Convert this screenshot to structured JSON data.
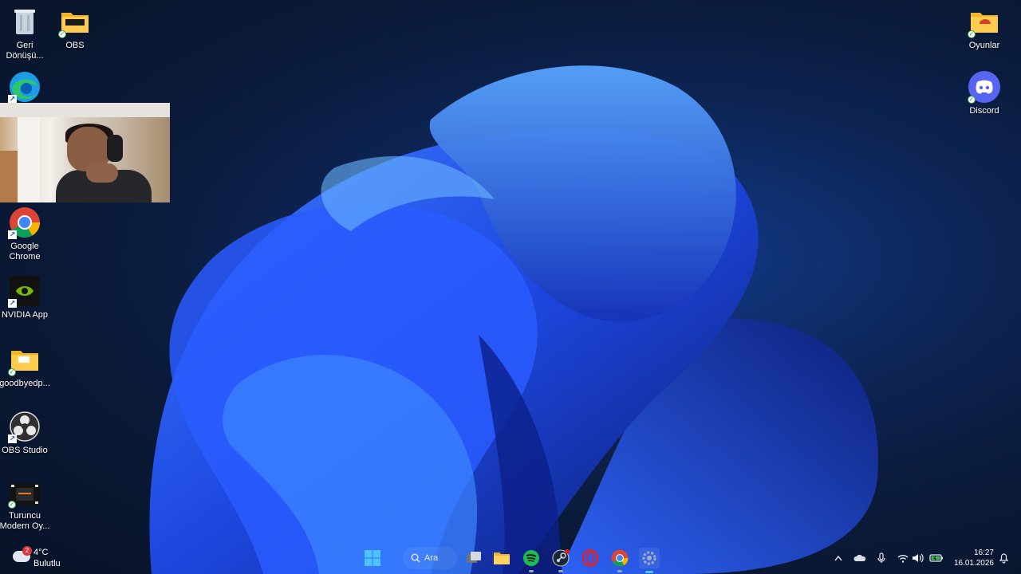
{
  "desktop": {
    "icons_left": [
      {
        "name": "recycle-bin",
        "label": "Geri\nDönüşü..."
      },
      {
        "name": "obs-folder",
        "label": "OBS"
      },
      {
        "name": "microsoft-edge",
        "label": ""
      },
      {
        "name": "google-chrome",
        "label": "Google\nChrome"
      },
      {
        "name": "nvidia-app",
        "label": "NVIDIA App"
      },
      {
        "name": "goodbyedp-folder",
        "label": "goodbyedp..."
      },
      {
        "name": "obs-studio",
        "label": "OBS Studio"
      },
      {
        "name": "turuncu-modern",
        "label": "Turuncu\nModern Oy..."
      }
    ],
    "icons_right": [
      {
        "name": "oyunlar-folder",
        "label": "Oyunlar"
      },
      {
        "name": "discord",
        "label": "Discord"
      }
    ]
  },
  "weather": {
    "temperature": "4°C",
    "description": "Bulutlu",
    "notification_count": "2"
  },
  "taskbar": {
    "search_label": "Ara",
    "apps": [
      "start",
      "search",
      "task-view",
      "file-explorer",
      "spotify",
      "steam",
      "opera-gx",
      "chrome",
      "settings"
    ]
  },
  "clock": {
    "time": "16:27",
    "date": "16.01.2026"
  },
  "colors": {
    "accent": "#1a5fd1",
    "wallpaper_bloom": "#2356e8",
    "discord": "#5865f2",
    "spotify": "#1db954",
    "nvidia": "#76b900",
    "opera": "#e0202a"
  }
}
